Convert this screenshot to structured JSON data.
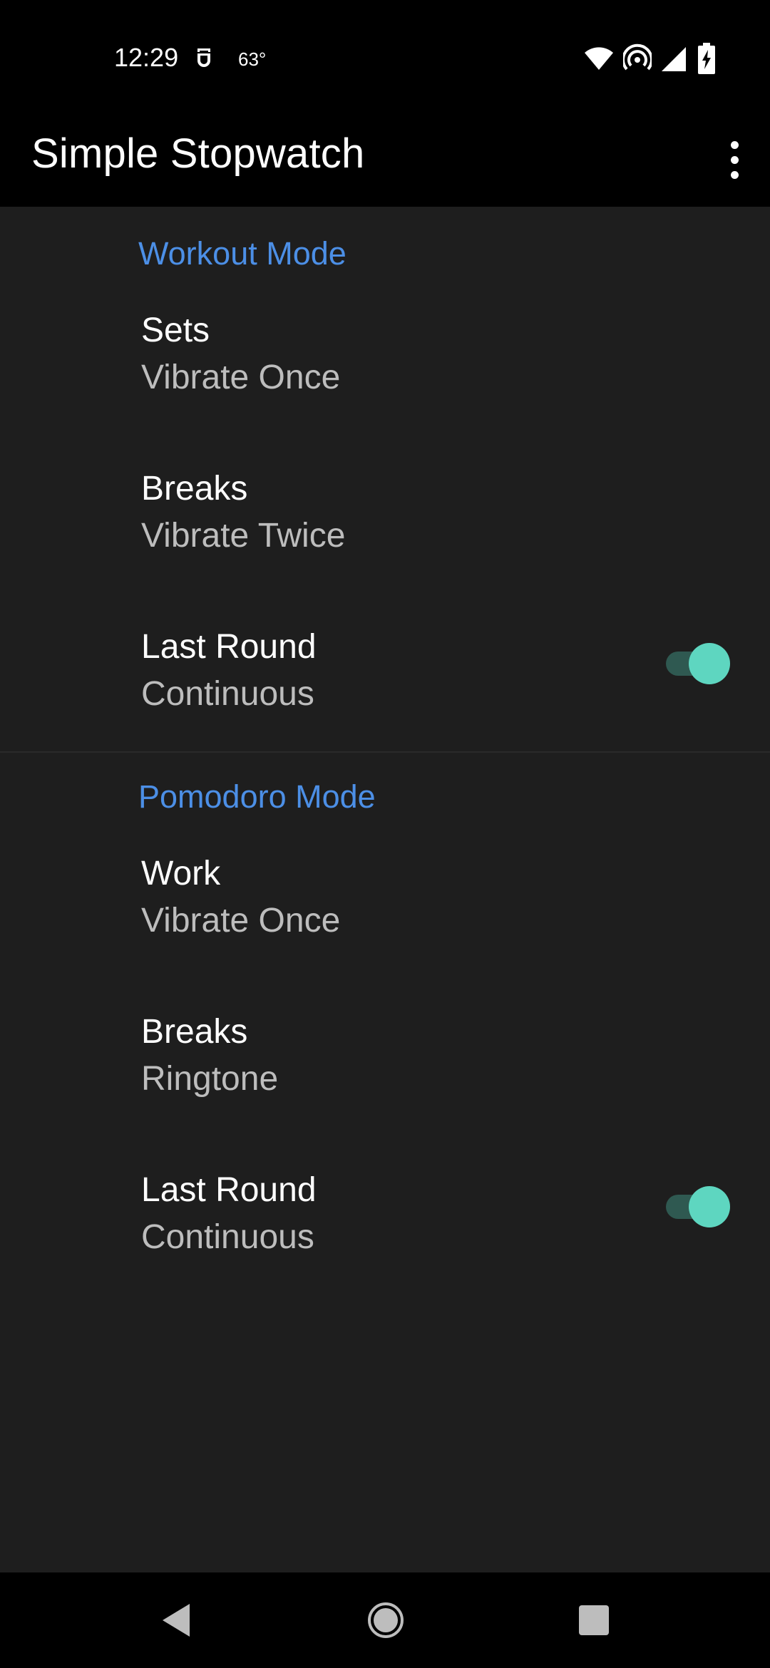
{
  "status_bar": {
    "time": "12:29",
    "weather": "63°",
    "icons": [
      "notification-icon",
      "wifi-icon",
      "hotspot-icon",
      "signal-icon",
      "battery-charging-icon"
    ]
  },
  "app_bar": {
    "title": "Simple Stopwatch",
    "menu_icon": "more-vert-icon"
  },
  "sections": [
    {
      "header": "Workout Mode",
      "items": [
        {
          "title": "Sets",
          "summary": "Vibrate Once"
        },
        {
          "title": "Breaks",
          "summary": "Vibrate Twice"
        },
        {
          "title": "Last Round",
          "summary": "Continuous",
          "toggle_on": true
        }
      ]
    },
    {
      "header": "Pomodoro Mode",
      "items": [
        {
          "title": "Work",
          "summary": "Vibrate Once"
        },
        {
          "title": "Breaks",
          "summary": "Ringtone"
        },
        {
          "title": "Last Round",
          "summary": "Continuous",
          "toggle_on": true
        }
      ]
    }
  ],
  "colors": {
    "accent": "#4c8fe6",
    "toggle_thumb": "#5ed6c0",
    "toggle_track": "#2f5951",
    "background": "#1e1e1e"
  },
  "nav_bar": {
    "buttons": [
      "back-icon",
      "home-icon",
      "recents-icon"
    ]
  }
}
